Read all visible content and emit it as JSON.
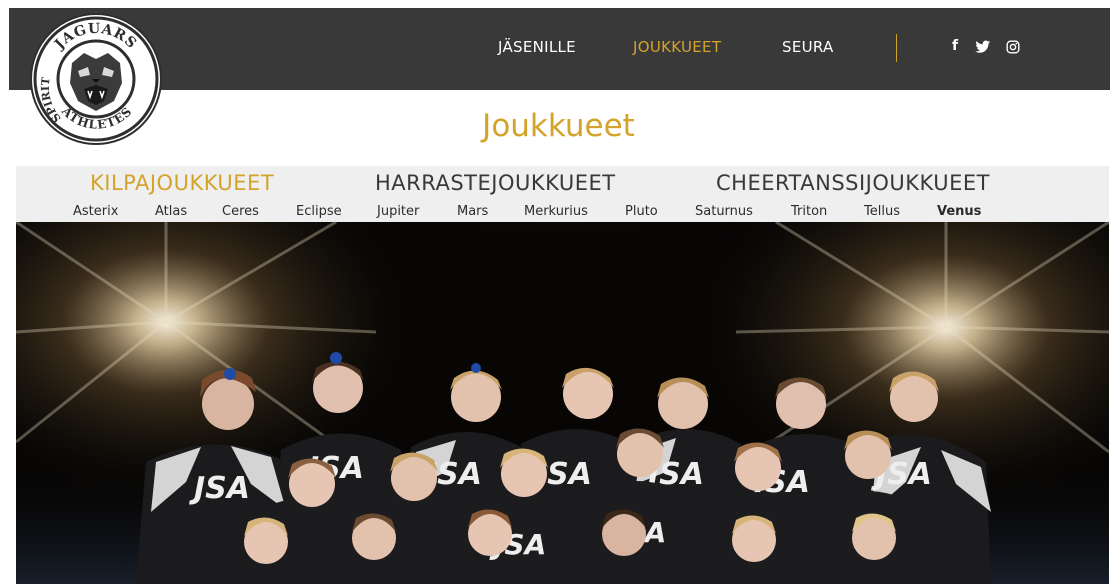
{
  "logo": {
    "top_text": "JAGUARS",
    "left_text": "SPIRIT",
    "bottom_text": "ATHLETES",
    "icon": "jaguar-head-icon"
  },
  "nav": {
    "items": [
      {
        "label": "JÄSENILLE",
        "active": false
      },
      {
        "label": "JOUKKUEET",
        "active": true
      },
      {
        "label": "SEURA",
        "active": false
      }
    ],
    "social": [
      {
        "icon": "facebook-icon",
        "glyph": "f"
      },
      {
        "icon": "twitter-icon",
        "glyph": "🐦"
      },
      {
        "icon": "instagram-icon",
        "glyph": "◎"
      }
    ]
  },
  "page": {
    "title": "Joukkueet"
  },
  "categories": [
    {
      "label": "KILPAJOUKKUEET",
      "active": true
    },
    {
      "label": "HARRASTEJOUKKUEET",
      "active": false
    },
    {
      "label": "CHEERTANSSIJOUKKUEET",
      "active": false
    }
  ],
  "teams": [
    {
      "label": "Asterix",
      "active": false
    },
    {
      "label": "Atlas",
      "active": false
    },
    {
      "label": "Ceres",
      "active": false
    },
    {
      "label": "Eclipse",
      "active": false
    },
    {
      "label": "Jupiter",
      "active": false
    },
    {
      "label": "Mars",
      "active": false
    },
    {
      "label": "Merkurius",
      "active": false
    },
    {
      "label": "Pluto",
      "active": false
    },
    {
      "label": "Saturnus",
      "active": false
    },
    {
      "label": "Triton",
      "active": false
    },
    {
      "label": "Tellus",
      "active": false
    },
    {
      "label": "Venus",
      "active": true
    }
  ],
  "photo": {
    "jersey_text": "JSA"
  },
  "colors": {
    "accent": "#d4a42a",
    "header_bg": "#3a3939",
    "category_bar_bg": "#efefef"
  }
}
